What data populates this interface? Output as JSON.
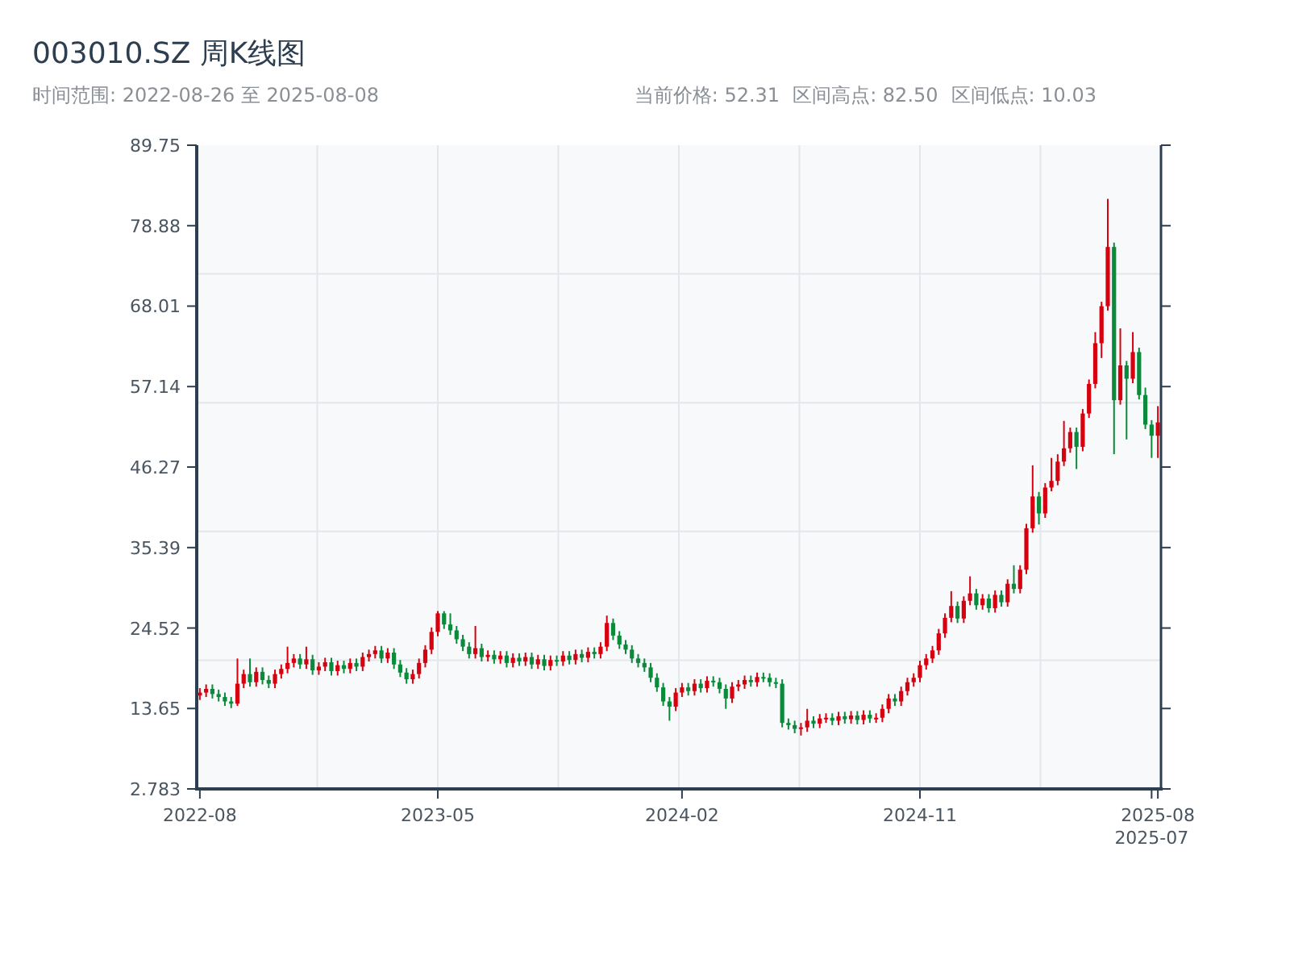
{
  "title": "003010.SZ 周K线图",
  "range": "时间范围: 2022-08-26 至 2025-08-08",
  "stats": [
    "当前价格: 52.31",
    "区间高点: 82.50",
    "区间低点: 10.03"
  ],
  "chart_data": {
    "type": "candlestick",
    "ylim": [
      2.783,
      89.75
    ],
    "yticks": [
      2.783,
      13.65,
      24.52,
      35.39,
      46.27,
      57.14,
      68.01,
      78.88,
      89.75
    ],
    "categories": [
      "2022-08",
      null,
      null,
      null,
      null,
      null,
      null,
      null,
      null,
      null,
      null,
      null,
      null,
      null,
      null,
      null,
      null,
      null,
      null,
      null,
      null,
      null,
      null,
      null,
      null,
      null,
      null,
      null,
      null,
      null,
      null,
      null,
      null,
      null,
      null,
      null,
      null,
      null,
      "2023-05",
      null,
      null,
      null,
      null,
      null,
      null,
      null,
      null,
      null,
      null,
      null,
      null,
      null,
      null,
      null,
      null,
      null,
      null,
      null,
      null,
      null,
      null,
      null,
      null,
      null,
      null,
      null,
      null,
      null,
      null,
      null,
      null,
      null,
      null,
      null,
      null,
      null,
      null,
      "2024-02",
      null,
      null,
      null,
      null,
      null,
      null,
      null,
      null,
      null,
      null,
      null,
      null,
      null,
      null,
      null,
      null,
      null,
      null,
      null,
      null,
      null,
      null,
      null,
      null,
      null,
      null,
      null,
      null,
      null,
      null,
      null,
      null,
      null,
      null,
      null,
      null,
      null,
      "2024-11",
      null,
      null,
      null,
      null,
      null,
      null,
      null,
      null,
      null,
      null,
      null,
      null,
      null,
      null,
      null,
      null,
      null,
      null,
      null,
      null,
      null,
      null,
      null,
      null,
      null,
      null,
      null,
      null,
      null,
      null,
      null,
      null,
      null,
      null,
      null,
      null,
      "2025-07",
      "2025-08"
    ],
    "ohlc": [
      [
        15.4,
        16.4,
        14.8,
        15.8
      ],
      [
        15.8,
        16.9,
        15.2,
        16.3
      ],
      [
        16.3,
        16.9,
        15.0,
        15.6
      ],
      [
        15.6,
        16.2,
        14.6,
        15.2
      ],
      [
        15.2,
        15.8,
        14.0,
        14.6
      ],
      [
        14.6,
        15.2,
        13.7,
        14.3
      ],
      [
        14.3,
        20.4,
        14.0,
        17.0
      ],
      [
        17.0,
        18.9,
        16.4,
        18.3
      ],
      [
        18.3,
        20.4,
        16.6,
        17.2
      ],
      [
        17.2,
        19.2,
        16.6,
        18.6
      ],
      [
        18.6,
        19.2,
        16.9,
        17.5
      ],
      [
        17.5,
        18.1,
        16.4,
        17.0
      ],
      [
        17.0,
        18.9,
        16.4,
        18.3
      ],
      [
        18.3,
        19.6,
        17.7,
        19.0
      ],
      [
        19.0,
        22.0,
        18.4,
        19.8
      ],
      [
        19.8,
        21.0,
        19.2,
        20.4
      ],
      [
        20.4,
        21.0,
        19.0,
        19.6
      ],
      [
        19.6,
        22.0,
        19.0,
        20.3
      ],
      [
        20.3,
        20.9,
        18.2,
        18.8
      ],
      [
        18.8,
        19.9,
        18.2,
        19.3
      ],
      [
        19.3,
        20.5,
        18.7,
        19.9
      ],
      [
        19.9,
        20.5,
        18.1,
        18.7
      ],
      [
        18.7,
        20.1,
        18.1,
        19.5
      ],
      [
        19.5,
        20.1,
        18.4,
        19.0
      ],
      [
        19.0,
        20.4,
        18.4,
        19.8
      ],
      [
        19.8,
        20.4,
        18.7,
        19.3
      ],
      [
        19.3,
        21.2,
        18.7,
        20.6
      ],
      [
        20.6,
        21.6,
        20.0,
        21.0
      ],
      [
        21.0,
        22.1,
        20.4,
        21.5
      ],
      [
        21.5,
        22.1,
        19.8,
        20.4
      ],
      [
        20.4,
        21.8,
        19.8,
        21.2
      ],
      [
        21.2,
        21.8,
        19.0,
        19.6
      ],
      [
        19.6,
        20.2,
        17.9,
        18.5
      ],
      [
        18.5,
        19.1,
        17.0,
        17.6
      ],
      [
        17.6,
        18.9,
        17.0,
        18.3
      ],
      [
        18.3,
        20.4,
        17.7,
        19.8
      ],
      [
        19.8,
        22.2,
        19.2,
        21.6
      ],
      [
        21.6,
        24.6,
        21.0,
        24.0
      ],
      [
        24.0,
        26.8,
        23.4,
        26.5
      ],
      [
        26.5,
        26.8,
        24.4,
        25.0
      ],
      [
        25.0,
        26.5,
        23.6,
        24.2
      ],
      [
        24.2,
        24.8,
        22.4,
        23.0
      ],
      [
        23.0,
        23.6,
        21.4,
        22.0
      ],
      [
        22.0,
        22.6,
        20.4,
        21.0
      ],
      [
        21.0,
        24.8,
        20.4,
        21.8
      ],
      [
        21.8,
        22.4,
        20.0,
        20.6
      ],
      [
        20.6,
        21.5,
        20.0,
        20.9
      ],
      [
        20.9,
        21.5,
        19.7,
        20.3
      ],
      [
        20.3,
        21.4,
        19.7,
        20.8
      ],
      [
        20.8,
        21.4,
        19.2,
        19.8
      ],
      [
        19.8,
        21.1,
        19.2,
        20.5
      ],
      [
        20.5,
        21.1,
        19.4,
        20.0
      ],
      [
        20.0,
        21.2,
        19.4,
        20.6
      ],
      [
        20.6,
        21.2,
        19.0,
        19.6
      ],
      [
        19.6,
        20.9,
        19.0,
        20.3
      ],
      [
        20.3,
        20.9,
        18.8,
        19.4
      ],
      [
        19.4,
        20.8,
        18.8,
        20.2
      ],
      [
        20.2,
        20.8,
        19.4,
        20.0
      ],
      [
        20.0,
        21.4,
        19.4,
        20.8
      ],
      [
        20.8,
        21.4,
        19.6,
        20.2
      ],
      [
        20.2,
        21.6,
        19.6,
        21.0
      ],
      [
        21.0,
        21.6,
        19.9,
        20.5
      ],
      [
        20.5,
        21.9,
        19.9,
        21.3
      ],
      [
        21.3,
        21.9,
        20.4,
        21.0
      ],
      [
        21.0,
        22.6,
        20.4,
        22.0
      ],
      [
        22.0,
        26.2,
        21.4,
        25.2
      ],
      [
        25.2,
        25.8,
        22.9,
        23.5
      ],
      [
        23.5,
        24.1,
        21.7,
        22.3
      ],
      [
        22.3,
        22.9,
        21.0,
        21.6
      ],
      [
        21.6,
        22.2,
        19.8,
        20.4
      ],
      [
        20.4,
        21.0,
        19.2,
        19.8
      ],
      [
        19.8,
        20.4,
        18.6,
        19.2
      ],
      [
        19.2,
        19.8,
        17.2,
        17.8
      ],
      [
        17.8,
        18.4,
        15.9,
        16.5
      ],
      [
        16.5,
        17.1,
        14.0,
        14.6
      ],
      [
        14.6,
        15.2,
        12.0,
        13.9
      ],
      [
        13.9,
        16.4,
        13.3,
        15.8
      ],
      [
        15.8,
        17.1,
        15.2,
        16.5
      ],
      [
        16.5,
        17.1,
        15.4,
        16.0
      ],
      [
        16.0,
        17.6,
        15.4,
        17.0
      ],
      [
        17.0,
        17.6,
        15.8,
        16.4
      ],
      [
        16.4,
        18.0,
        15.8,
        17.4
      ],
      [
        17.4,
        18.0,
        16.6,
        17.2
      ],
      [
        17.2,
        17.8,
        15.7,
        16.3
      ],
      [
        16.3,
        16.9,
        13.6,
        15.0
      ],
      [
        15.0,
        17.2,
        14.4,
        16.6
      ],
      [
        16.6,
        17.5,
        16.0,
        16.9
      ],
      [
        16.9,
        18.1,
        16.3,
        17.5
      ],
      [
        17.5,
        18.1,
        16.6,
        17.2
      ],
      [
        17.2,
        18.5,
        16.6,
        17.9
      ],
      [
        17.9,
        18.5,
        17.2,
        17.8
      ],
      [
        17.8,
        18.4,
        16.6,
        17.2
      ],
      [
        17.2,
        17.8,
        16.4,
        17.0
      ],
      [
        17.0,
        17.6,
        11.1,
        11.7
      ],
      [
        11.7,
        12.3,
        10.8,
        11.4
      ],
      [
        11.4,
        12.0,
        10.3,
        10.9
      ],
      [
        10.9,
        11.7,
        10.0,
        11.1
      ],
      [
        11.1,
        13.6,
        10.5,
        12.0
      ],
      [
        12.0,
        12.6,
        11.0,
        11.6
      ],
      [
        11.6,
        12.9,
        11.0,
        12.3
      ],
      [
        12.3,
        13.0,
        11.7,
        12.4
      ],
      [
        12.4,
        13.0,
        11.4,
        12.0
      ],
      [
        12.0,
        13.2,
        11.4,
        12.6
      ],
      [
        12.6,
        13.2,
        11.6,
        12.2
      ],
      [
        12.2,
        13.3,
        11.6,
        12.7
      ],
      [
        12.7,
        13.3,
        11.5,
        12.1
      ],
      [
        12.1,
        13.4,
        11.5,
        12.8
      ],
      [
        12.8,
        13.4,
        11.7,
        12.3
      ],
      [
        12.3,
        13.0,
        11.7,
        12.4
      ],
      [
        12.4,
        14.2,
        11.8,
        13.6
      ],
      [
        13.6,
        15.6,
        13.0,
        15.0
      ],
      [
        15.0,
        15.6,
        14.0,
        14.6
      ],
      [
        14.6,
        16.6,
        14.0,
        16.0
      ],
      [
        16.0,
        17.8,
        15.4,
        17.2
      ],
      [
        17.2,
        18.4,
        16.6,
        17.8
      ],
      [
        17.8,
        20.1,
        17.2,
        19.5
      ],
      [
        19.5,
        21.0,
        18.9,
        20.4
      ],
      [
        20.4,
        22.1,
        19.8,
        21.5
      ],
      [
        21.5,
        24.4,
        20.9,
        23.8
      ],
      [
        23.8,
        26.5,
        23.2,
        25.9
      ],
      [
        25.9,
        29.5,
        25.3,
        27.5
      ],
      [
        27.5,
        28.1,
        25.2,
        25.8
      ],
      [
        25.8,
        28.8,
        25.2,
        28.2
      ],
      [
        28.2,
        31.5,
        27.6,
        29.2
      ],
      [
        29.2,
        29.8,
        27.0,
        27.6
      ],
      [
        27.6,
        29.1,
        27.0,
        28.5
      ],
      [
        28.5,
        29.1,
        26.6,
        27.2
      ],
      [
        27.2,
        29.6,
        26.6,
        29.0
      ],
      [
        29.0,
        29.6,
        27.4,
        28.0
      ],
      [
        28.0,
        31.1,
        27.4,
        30.5
      ],
      [
        30.5,
        33.0,
        29.2,
        29.8
      ],
      [
        29.8,
        33.0,
        29.2,
        32.4
      ],
      [
        32.4,
        38.6,
        31.8,
        38.0
      ],
      [
        38.0,
        46.5,
        37.4,
        42.3
      ],
      [
        42.3,
        42.9,
        38.5,
        40.0
      ],
      [
        40.0,
        44.1,
        39.4,
        43.5
      ],
      [
        43.5,
        47.5,
        43.0,
        44.4
      ],
      [
        44.4,
        48.0,
        43.8,
        47.0
      ],
      [
        47.0,
        52.5,
        46.4,
        48.8
      ],
      [
        48.8,
        51.6,
        48.2,
        51.0
      ],
      [
        51.0,
        51.6,
        46.0,
        49.0
      ],
      [
        49.0,
        54.1,
        48.4,
        53.5
      ],
      [
        53.5,
        58.1,
        52.9,
        57.5
      ],
      [
        57.5,
        64.5,
        56.9,
        63.0
      ],
      [
        63.0,
        68.6,
        61.0,
        68.0
      ],
      [
        68.0,
        82.5,
        67.4,
        76.0
      ],
      [
        76.0,
        76.6,
        48.0,
        55.3
      ],
      [
        55.3,
        65.0,
        54.7,
        60.0
      ],
      [
        60.0,
        60.6,
        50.0,
        58.2
      ],
      [
        58.2,
        64.5,
        57.6,
        61.8
      ],
      [
        61.8,
        62.4,
        55.4,
        56.0
      ],
      [
        56.0,
        57.0,
        51.4,
        52.0
      ],
      [
        52.0,
        52.6,
        47.5,
        50.5
      ],
      [
        50.5,
        54.5,
        47.5,
        52.3
      ]
    ]
  }
}
